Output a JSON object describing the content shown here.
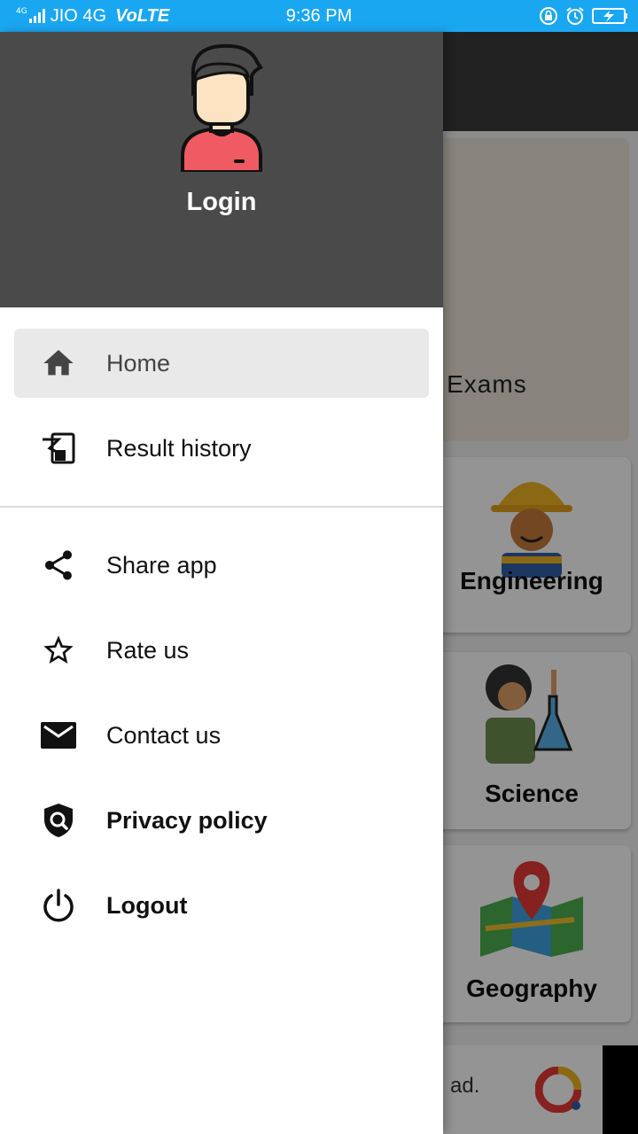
{
  "status_bar": {
    "signal_small": "4G",
    "carrier": "JIO 4G",
    "volte": "VoLTE",
    "time": "9:36 PM",
    "icons": [
      "rotation-lock-icon",
      "alarm-icon",
      "battery-charging-icon"
    ]
  },
  "drawer": {
    "header": {
      "login_label": "Login",
      "avatar_icon": "user-avatar-icon"
    },
    "menu": {
      "home": {
        "label": "Home",
        "icon": "home-icon",
        "selected": true
      },
      "result_history": {
        "label": "Result history",
        "icon": "history-icon"
      },
      "share_app": {
        "label": "Share app",
        "icon": "share-icon"
      },
      "rate_us": {
        "label": "Rate us",
        "icon": "star-icon"
      },
      "contact_us": {
        "label": "Contact us",
        "icon": "mail-icon"
      },
      "privacy_policy": {
        "label": "Privacy policy",
        "icon": "privacy-shield-icon"
      },
      "logout": {
        "label": "Logout",
        "icon": "power-icon"
      }
    }
  },
  "background": {
    "banner_text": "of Exams",
    "cards": [
      {
        "label": "Engineering",
        "icon": "engineer-icon"
      },
      {
        "label": "Science",
        "icon": "scientist-icon"
      },
      {
        "label": "Geography",
        "icon": "map-pin-icon"
      }
    ],
    "ad_text": "ad."
  },
  "colors": {
    "status_bar": "#1aa7f2",
    "drawer_header": "#4a4a4a",
    "selected_item": "#e9e9e9"
  }
}
